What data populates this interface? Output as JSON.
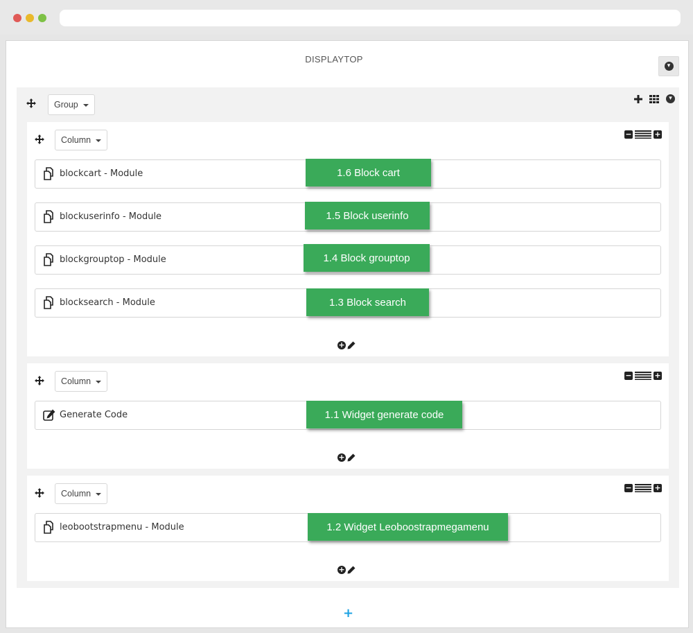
{
  "window": {
    "colors": {
      "close": "#e05a57",
      "minimize": "#e9b92c",
      "maximize": "#7dc145"
    }
  },
  "page": {
    "title": "DISPLAYTOP",
    "top_button_icon": "circle-arrow-down-icon"
  },
  "group": {
    "dropdown_label": "Group",
    "tools": [
      "plus-icon",
      "grid-icon",
      "circle-arrow-down-icon"
    ],
    "columns": [
      {
        "dropdown_label": "Column",
        "rows": [
          {
            "icon": "copy-icon",
            "label": "blockcart - Module",
            "tag": "1.6 Block cart"
          },
          {
            "icon": "copy-icon",
            "label": "blockuserinfo - Module",
            "tag": "1.5 Block userinfo"
          },
          {
            "icon": "copy-icon",
            "label": "blockgrouptop - Module",
            "tag": "1.4 Block grouptop"
          },
          {
            "icon": "copy-icon",
            "label": "blocksearch - Module",
            "tag": "1.3 Block search"
          }
        ]
      },
      {
        "dropdown_label": "Column",
        "rows": [
          {
            "icon": "edit-icon",
            "label": "Generate Code",
            "tag": "1.1 Widget generate code"
          }
        ]
      },
      {
        "dropdown_label": "Column",
        "rows": [
          {
            "icon": "copy-icon",
            "label": "leobootstrapmenu - Module",
            "tag": "1.2 Widget Leoboostrapmegamenu"
          }
        ]
      }
    ]
  },
  "colors": {
    "tag_green": "#3aaa59",
    "add_blue": "#1ba1e2",
    "panel_gray": "#f2f2f2"
  },
  "add_group_symbol": "+"
}
